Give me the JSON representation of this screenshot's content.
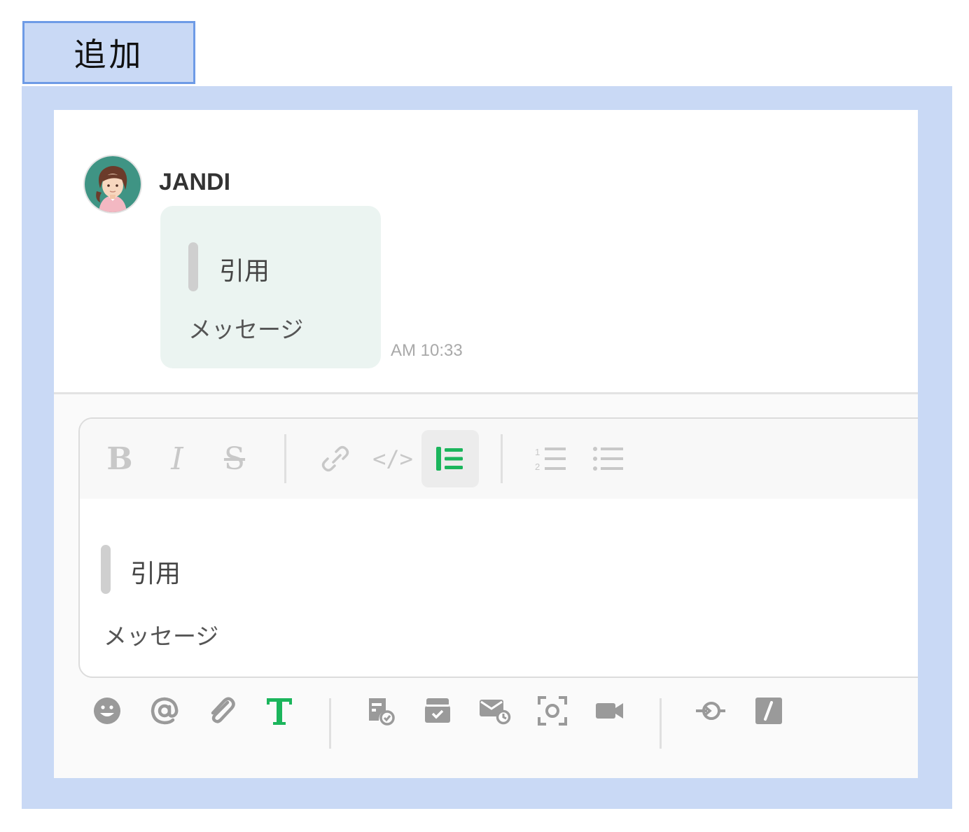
{
  "tag_label": "追加",
  "message": {
    "sender": "JANDI",
    "quote": "引用",
    "text": "メッセージ",
    "time": "AM 10:33"
  },
  "editor": {
    "toolbar": {
      "bold": "B",
      "italic": "I",
      "strikethrough": "S",
      "code": "</>"
    },
    "quote": "引用",
    "text": "メッセージ"
  },
  "icons": {
    "format": [
      "bold-icon",
      "italic-icon",
      "strikethrough-icon",
      "link-icon",
      "code-icon",
      "blockquote-icon",
      "ordered-list-icon",
      "bullet-list-icon"
    ],
    "bottom": [
      "emoji-icon",
      "mention-icon",
      "attachment-icon",
      "text-format-icon",
      "todo-icon",
      "archive-icon",
      "scheduled-mail-icon",
      "screen-capture-icon",
      "video-call-icon",
      "integration-icon",
      "slash-command-icon"
    ]
  },
  "colors": {
    "frame": "#c9d9f5",
    "frame_border": "#6e9be6",
    "accent_green": "#1bb55c",
    "bubble": "#ebf4f1",
    "icon_gray": "#9a9a9a",
    "toolbar_disabled": "#c8c8c8"
  }
}
